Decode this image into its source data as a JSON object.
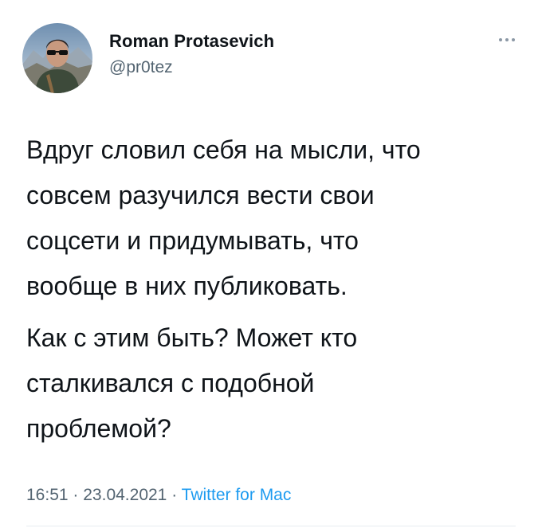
{
  "author": {
    "name": "Roman Protasevich",
    "handle": "@pr0tez",
    "avatar_icon": "profile-photo"
  },
  "more_icon": "ellipsis-icon",
  "tweet": {
    "paragraphs": [
      {
        "lines": [
          "Вдруг словил себя на мысли, что",
          "совсем разучился вести свои",
          "соцсети и придумывать, что",
          "вообще в них публиковать."
        ]
      },
      {
        "lines": [
          "Как с этим быть? Может кто",
          "сталкивался с подобной",
          "проблемой?"
        ]
      }
    ]
  },
  "meta": {
    "time": "16:51",
    "separator": "·",
    "date": "23.04.2021",
    "source": "Twitter for Mac"
  },
  "colors": {
    "text": "#0f1419",
    "secondary": "#536471",
    "link": "#1d9bf0"
  }
}
